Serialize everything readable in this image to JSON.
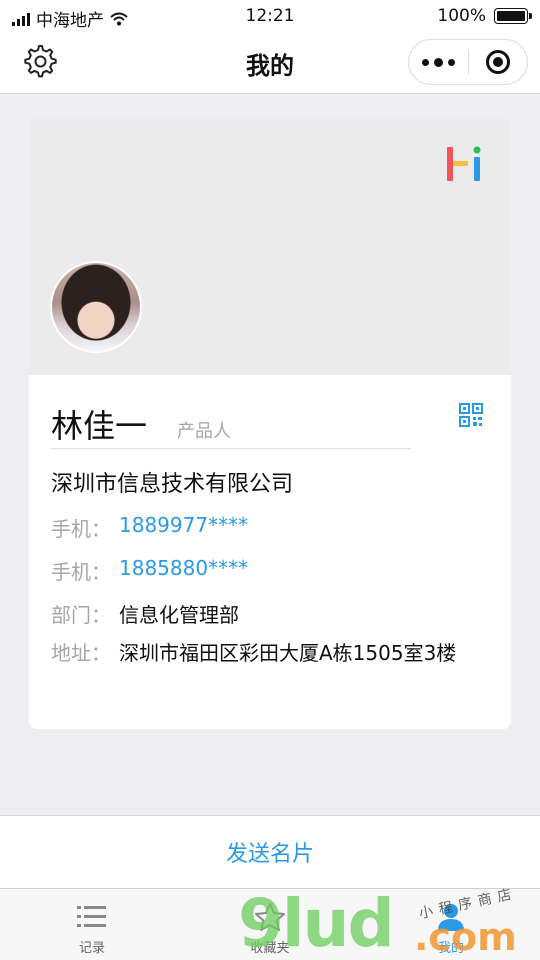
{
  "status_bar": {
    "carrier": "中海地产",
    "time": "12:21",
    "battery": "100%",
    "battery_level": 1.0
  },
  "nav": {
    "title": "我的",
    "settings_icon": "gear-icon",
    "more_icon": "more-dots-icon",
    "close_icon": "target-circle-icon"
  },
  "card": {
    "logo_icon": "hi-logo",
    "logo_colors": [
      "#f2545b",
      "#f5c142",
      "#2b9ae6",
      "#2fbf4f"
    ],
    "name": "林佳一",
    "title": "产品人",
    "company": "深圳市信息技术有限公司",
    "rows": [
      {
        "label": "手机：",
        "value": "1889977****"
      },
      {
        "label": "手机：",
        "value": "1885880****"
      },
      {
        "label": "部门：",
        "value": "信息化管理部"
      },
      {
        "label": "地址：",
        "value": "深圳市福田区彩田大厦A栋1505室3楼"
      }
    ]
  },
  "send_button": "发送名片",
  "tabs": [
    {
      "label": "记录",
      "icon": "list-icon"
    },
    {
      "label": "收藏夹",
      "icon": "star-icon"
    },
    {
      "label": "我的",
      "icon": "person-icon"
    }
  ],
  "watermark": {
    "main": "9lud",
    "suffix": ".com",
    "sub": "小程序商店"
  },
  "colors": {
    "accent": "#2b9ae6",
    "muted_text": "#a6a6a6",
    "header_bg": "#ebebeb"
  }
}
